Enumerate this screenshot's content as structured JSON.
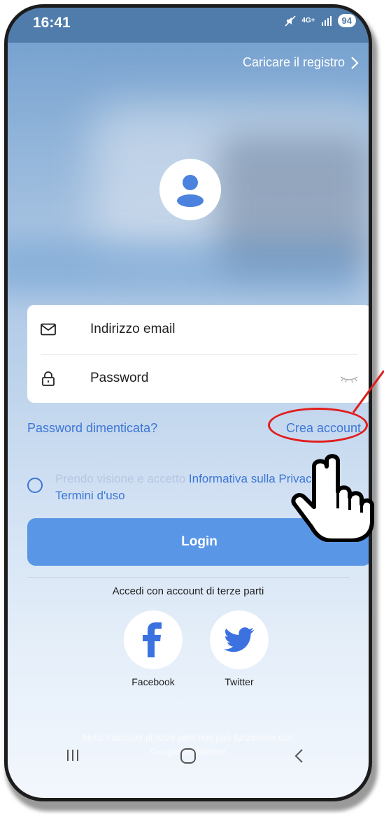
{
  "status_bar": {
    "time": "16:41",
    "network": "4G+",
    "battery": "94"
  },
  "header": {
    "register_link": "Caricare il registro"
  },
  "form": {
    "email_placeholder": "Indirizzo email",
    "password_placeholder": "Password"
  },
  "links": {
    "forgot_password": "Password dimenticata?",
    "create_account": "Crea account"
  },
  "consent": {
    "prefix": "Prendo visione e accetto",
    "privacy": "Informativa sulla Privacy e",
    "terms": "Termini d'uso"
  },
  "login": {
    "label": "Login"
  },
  "third_party": {
    "title": "Accedi con account di terze parti",
    "providers": [
      {
        "name": "Facebook"
      },
      {
        "name": "Twitter"
      }
    ]
  },
  "footer_note": {
    "line1": "Nota: l'account di terze parti non può funzionare con",
    "line2": "Google Assistance"
  },
  "colors": {
    "accent": "#3c76d6",
    "login_button": "#5a96e6",
    "annotation": "#e11d1d"
  },
  "icons": [
    "mail-icon",
    "lock-icon",
    "eye-closed-icon",
    "user-avatar-icon",
    "facebook-icon",
    "twitter-icon",
    "chevron-right-icon",
    "hand-pointer-icon"
  ]
}
